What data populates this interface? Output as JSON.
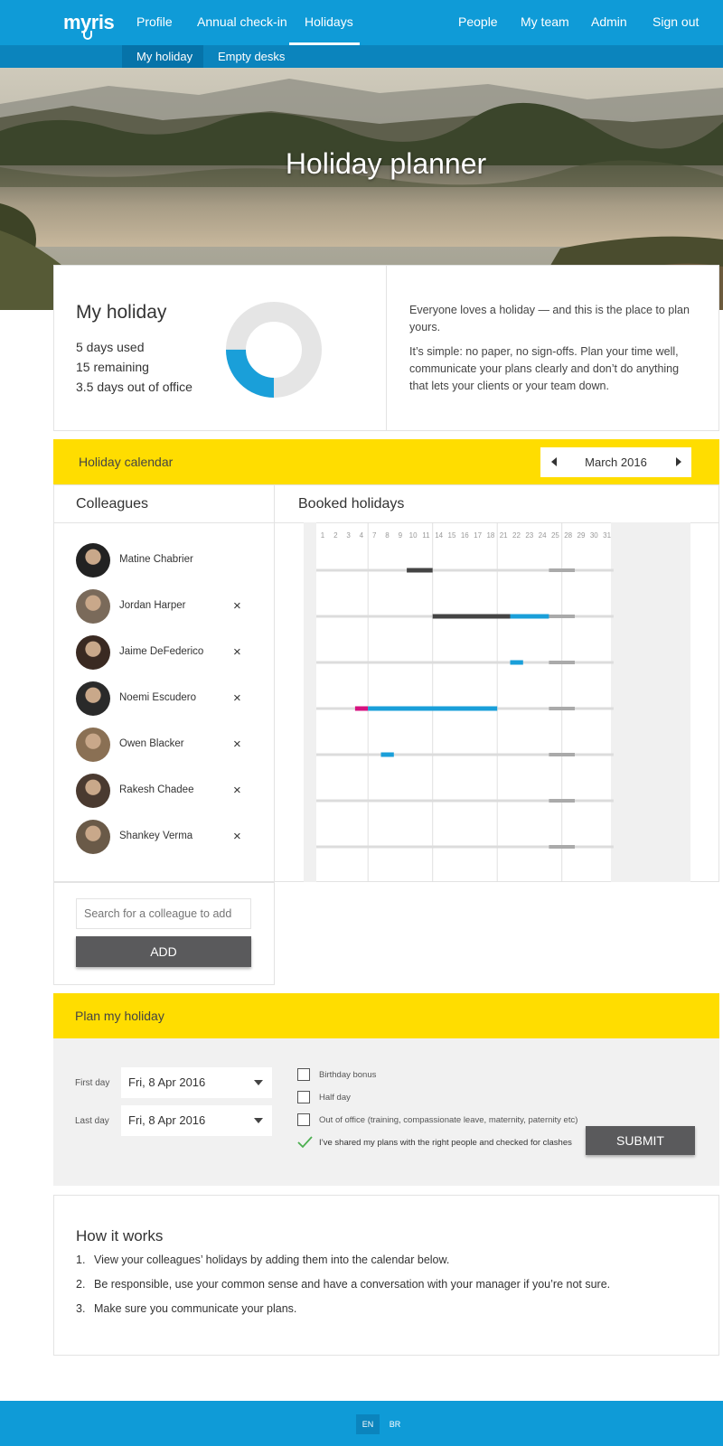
{
  "nav": {
    "logo": "myris",
    "items": [
      "Profile",
      "Annual check-in",
      "Holidays"
    ],
    "right_items": [
      "People",
      "My team",
      "Admin",
      "Sign out"
    ],
    "active": "Holidays"
  },
  "subnav": {
    "items": [
      "My holiday",
      "Empty desks"
    ],
    "active": "My holiday"
  },
  "hero": {
    "title": "Holiday planner"
  },
  "my_holiday": {
    "title": "My holiday",
    "stats": [
      "5 days used",
      "15 remaining",
      "3.5 days out of office"
    ],
    "used_fraction": 0.25,
    "colors": {
      "used": "#1a9fd9",
      "remaining": "#e5e5e5"
    },
    "intro": "Everyone loves a holiday — and this is the place to plan yours.",
    "body": "It’s simple: no paper, no sign-offs. Plan your time well, communicate your plans clearly and don’t do anything that lets your clients or your team down."
  },
  "calendar": {
    "title": "Holiday calendar",
    "month": "March 2016",
    "colleagues_heading": "Colleagues",
    "booked_heading": "Booked holidays",
    "day_labels": [
      "1",
      "2",
      "3",
      "4",
      "7",
      "8",
      "9",
      "10",
      "11",
      "14",
      "15",
      "16",
      "17",
      "18",
      "21",
      "22",
      "23",
      "24",
      "25",
      "28",
      "29",
      "30",
      "31"
    ],
    "colleagues": [
      {
        "name": "Matine Chabrier",
        "removable": false
      },
      {
        "name": "Jordan Harper",
        "removable": true
      },
      {
        "name": "Jaime DeFederico",
        "removable": true
      },
      {
        "name": "Noemi Escudero",
        "removable": true
      },
      {
        "name": "Owen Blacker",
        "removable": true
      },
      {
        "name": "Rakesh Chadee",
        "removable": true
      },
      {
        "name": "Shankey Verma",
        "removable": true
      }
    ],
    "remove_icon": "×",
    "bookings": [
      [
        {
          "from": 7,
          "to": 9,
          "kind": "dark"
        }
      ],
      [
        {
          "from": 9,
          "to": 15,
          "kind": "dark"
        },
        {
          "from": 15,
          "to": 18,
          "kind": "blue"
        }
      ],
      [
        {
          "from": 15,
          "to": 16,
          "kind": "blue"
        }
      ],
      [
        {
          "from": 3,
          "to": 4,
          "kind": "magenta"
        },
        {
          "from": 4,
          "to": 14,
          "kind": "blue"
        }
      ],
      [
        {
          "from": 5,
          "to": 6,
          "kind": "blue"
        }
      ],
      [],
      []
    ],
    "bank_holiday": {
      "from": 18,
      "to": 20
    },
    "colors": {
      "dark": "#444444",
      "blue": "#1a9fd9",
      "magenta": "#d6127f",
      "base": "#dcdcdc",
      "bank": "#aaaaaa"
    },
    "search_placeholder": "Search for a colleague to add",
    "add_label": "ADD"
  },
  "plan": {
    "title": "Plan my holiday",
    "first_day_label": "First day",
    "first_day_value": "Fri, 8 Apr 2016",
    "last_day_label": "Last day",
    "last_day_value": "Fri, 8 Apr 2016",
    "options": [
      "Birthday bonus",
      "Half day",
      "Out of office (training, compassionate leave, maternity, paternity etc)"
    ],
    "confirmation": "I’ve shared my plans with the right people and checked for clashes",
    "submit_label": "SUBMIT"
  },
  "how_it_works": {
    "title": "How it works",
    "steps": [
      {
        "num": "1.",
        "text": "View your colleagues’ holidays by adding them into the calendar below."
      },
      {
        "num": "2.",
        "text": "Be responsible, use your common sense and have a conversation with your manager if you’re not sure."
      },
      {
        "num": "3.",
        "text": "Make sure you communicate your plans."
      }
    ]
  },
  "footer": {
    "languages": [
      "EN",
      "BR"
    ],
    "active": "EN"
  }
}
